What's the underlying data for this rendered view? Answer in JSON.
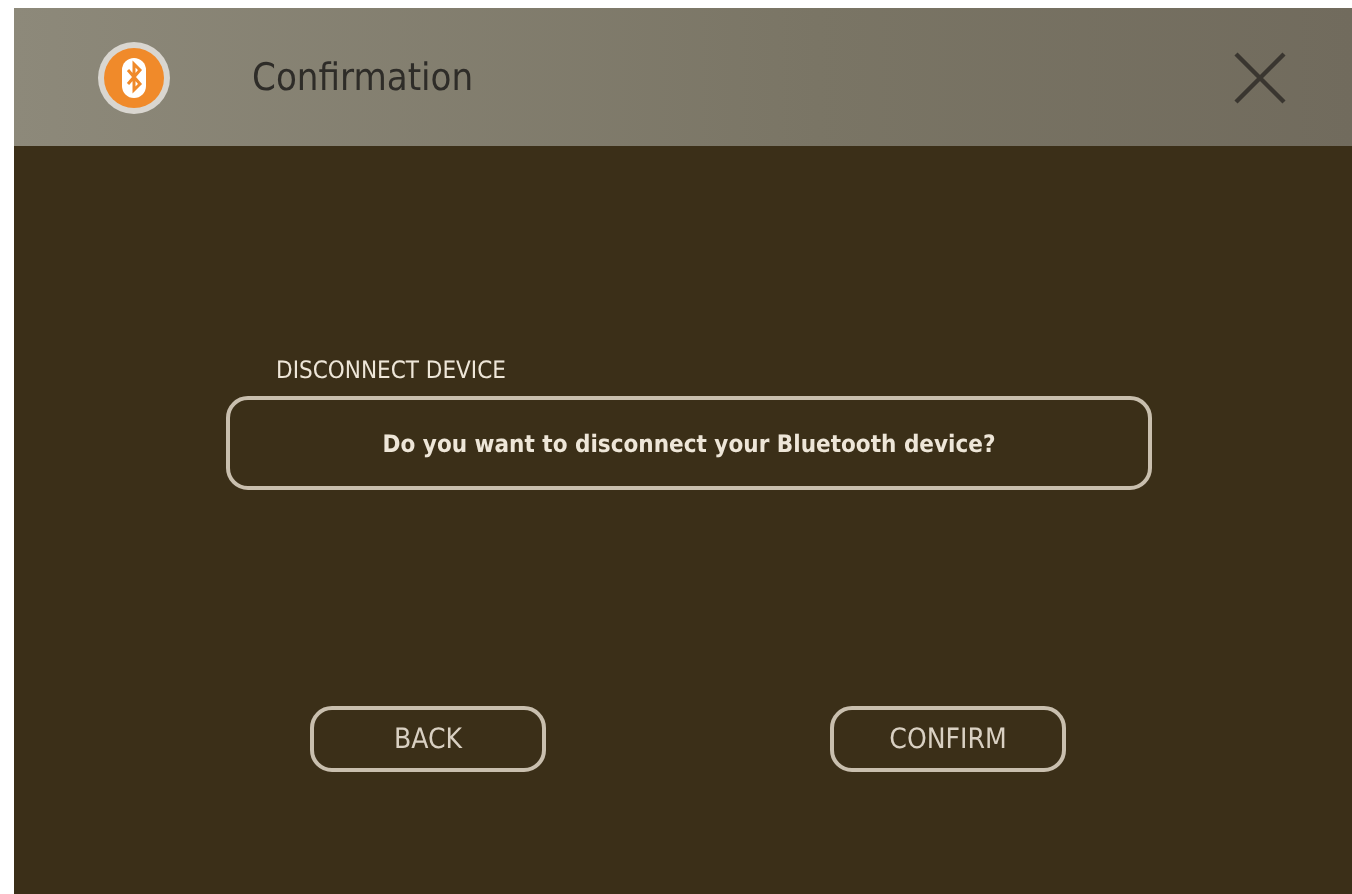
{
  "header": {
    "title": "Confirmation"
  },
  "dialog": {
    "label": "DISCONNECT DEVICE",
    "message": "Do you want to disconnect your Bluetooth device?"
  },
  "buttons": [
    {
      "label": "BACK"
    },
    {
      "label": "CONFIRM"
    }
  ]
}
